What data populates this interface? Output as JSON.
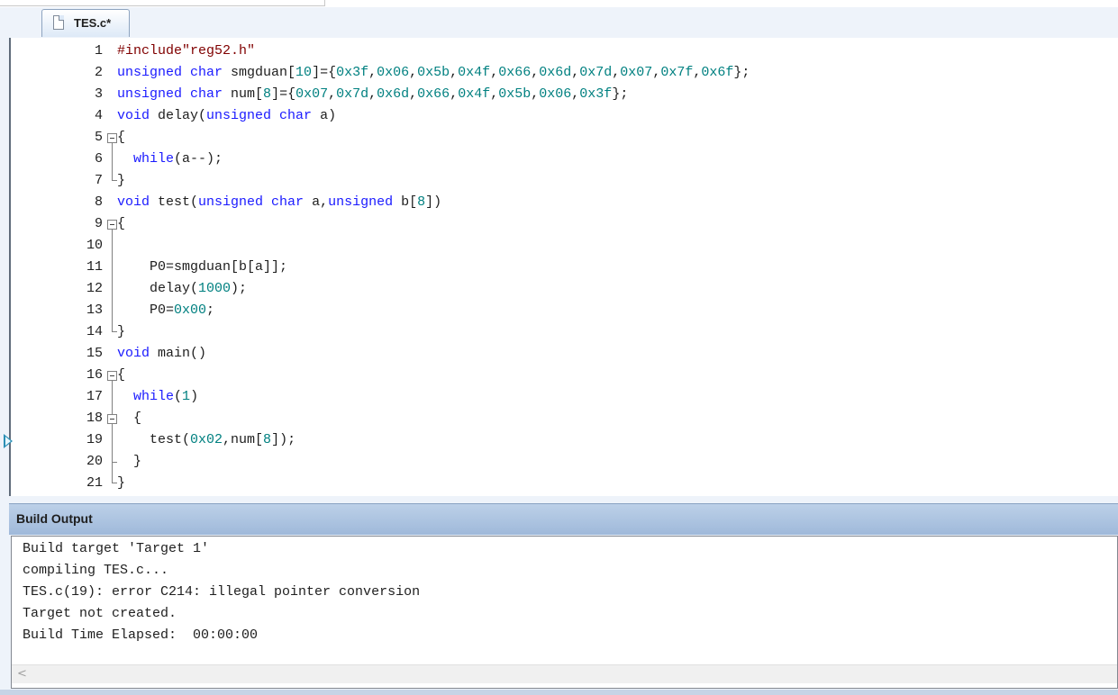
{
  "tab": {
    "filename": "TES.c*",
    "icon": "file-icon"
  },
  "editor": {
    "lines": [
      {
        "n": "1",
        "parts": [
          [
            "pp",
            "#include\"reg52.h\""
          ]
        ]
      },
      {
        "n": "2",
        "parts": [
          [
            "kw",
            "unsigned char"
          ],
          [
            "tx",
            " smgduan["
          ],
          [
            "num",
            "10"
          ],
          [
            "tx",
            "]={"
          ],
          [
            "num",
            "0x3f"
          ],
          [
            "tx",
            ","
          ],
          [
            "num",
            "0x06"
          ],
          [
            "tx",
            ","
          ],
          [
            "num",
            "0x5b"
          ],
          [
            "tx",
            ","
          ],
          [
            "num",
            "0x4f"
          ],
          [
            "tx",
            ","
          ],
          [
            "num",
            "0x66"
          ],
          [
            "tx",
            ","
          ],
          [
            "num",
            "0x6d"
          ],
          [
            "tx",
            ","
          ],
          [
            "num",
            "0x7d"
          ],
          [
            "tx",
            ","
          ],
          [
            "num",
            "0x07"
          ],
          [
            "tx",
            ","
          ],
          [
            "num",
            "0x7f"
          ],
          [
            "tx",
            ","
          ],
          [
            "num",
            "0x6f"
          ],
          [
            "tx",
            "};"
          ]
        ]
      },
      {
        "n": "3",
        "parts": [
          [
            "kw",
            "unsigned char"
          ],
          [
            "tx",
            " num["
          ],
          [
            "num",
            "8"
          ],
          [
            "tx",
            "]={"
          ],
          [
            "num",
            "0x07"
          ],
          [
            "tx",
            ","
          ],
          [
            "num",
            "0x7d"
          ],
          [
            "tx",
            ","
          ],
          [
            "num",
            "0x6d"
          ],
          [
            "tx",
            ","
          ],
          [
            "num",
            "0x66"
          ],
          [
            "tx",
            ","
          ],
          [
            "num",
            "0x4f"
          ],
          [
            "tx",
            ","
          ],
          [
            "num",
            "0x5b"
          ],
          [
            "tx",
            ","
          ],
          [
            "num",
            "0x06"
          ],
          [
            "tx",
            ","
          ],
          [
            "num",
            "0x3f"
          ],
          [
            "tx",
            "};"
          ]
        ]
      },
      {
        "n": "4",
        "parts": [
          [
            "kw",
            "void"
          ],
          [
            "tx",
            " delay("
          ],
          [
            "kw",
            "unsigned char"
          ],
          [
            "tx",
            " a)"
          ]
        ]
      },
      {
        "n": "5",
        "parts": [
          [
            "tx",
            "{"
          ]
        ]
      },
      {
        "n": "6",
        "parts": [
          [
            "tx",
            "  "
          ],
          [
            "kw",
            "while"
          ],
          [
            "tx",
            "(a--);"
          ]
        ]
      },
      {
        "n": "7",
        "parts": [
          [
            "tx",
            "}"
          ]
        ]
      },
      {
        "n": "8",
        "parts": [
          [
            "kw",
            "void"
          ],
          [
            "tx",
            " test("
          ],
          [
            "kw",
            "unsigned char"
          ],
          [
            "tx",
            " a,"
          ],
          [
            "kw",
            "unsigned"
          ],
          [
            "tx",
            " b["
          ],
          [
            "num",
            "8"
          ],
          [
            "tx",
            "])"
          ]
        ]
      },
      {
        "n": "9",
        "parts": [
          [
            "tx",
            "{"
          ]
        ]
      },
      {
        "n": "10",
        "parts": []
      },
      {
        "n": "11",
        "parts": [
          [
            "tx",
            "    P0=smgduan[b[a]];"
          ]
        ]
      },
      {
        "n": "12",
        "parts": [
          [
            "tx",
            "    delay("
          ],
          [
            "num",
            "1000"
          ],
          [
            "tx",
            ");"
          ]
        ]
      },
      {
        "n": "13",
        "parts": [
          [
            "tx",
            "    P0="
          ],
          [
            "num",
            "0x00"
          ],
          [
            "tx",
            ";"
          ]
        ]
      },
      {
        "n": "14",
        "parts": [
          [
            "tx",
            "}"
          ]
        ]
      },
      {
        "n": "15",
        "parts": [
          [
            "kw",
            "void"
          ],
          [
            "tx",
            " main()"
          ]
        ]
      },
      {
        "n": "16",
        "parts": [
          [
            "tx",
            "{"
          ]
        ]
      },
      {
        "n": "17",
        "parts": [
          [
            "tx",
            "  "
          ],
          [
            "kw",
            "while"
          ],
          [
            "tx",
            "("
          ],
          [
            "num",
            "1"
          ],
          [
            "tx",
            ")"
          ]
        ]
      },
      {
        "n": "18",
        "parts": [
          [
            "tx",
            "  {"
          ]
        ]
      },
      {
        "n": "19",
        "parts": [
          [
            "tx",
            "    test("
          ],
          [
            "num",
            "0x02"
          ],
          [
            "tx",
            ",num["
          ],
          [
            "num",
            "8"
          ],
          [
            "tx",
            "]);"
          ]
        ]
      },
      {
        "n": "20",
        "parts": [
          [
            "tx",
            "  }"
          ]
        ]
      },
      {
        "n": "21",
        "parts": [
          [
            "tx",
            "}"
          ]
        ]
      }
    ]
  },
  "build_output": {
    "title": "Build Output",
    "lines": [
      "Build target 'Target 1'",
      "compiling TES.c...",
      "TES.c(19): error C214: illegal pointer conversion",
      "Target not created.",
      "Build Time Elapsed:  00:00:00"
    ],
    "scroll_left": "<"
  },
  "colors": {
    "keyword": "#1a1aff",
    "number": "#008080",
    "preprocessor": "#800000",
    "text": "#1e1e1e"
  }
}
